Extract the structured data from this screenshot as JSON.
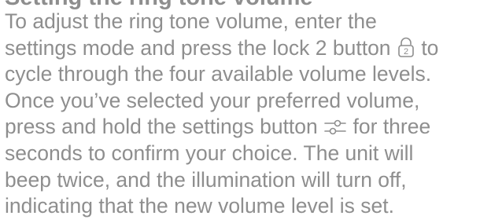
{
  "title": "Setting the ring tone volume",
  "paragraph": {
    "line1": "To adjust the ring tone volume, enter the",
    "line2_before_icon": "settings mode and press the lock 2 button",
    "line2_after_icon": "to",
    "line3": "cycle through the four available volume levels.",
    "line4": "Once you’ve selected your preferred volume,",
    "line5_before_icon": "press and hold the settings button",
    "line5_after_icon": "for three",
    "line6": "seconds to confirm your choice. The unit will",
    "line7": "beep twice, and the illumination will turn off,",
    "line8": "indicating that the new volume level is set."
  },
  "icons": {
    "lock": "lock-2-icon",
    "lock_number": "2",
    "settings": "settings-sliders-icon"
  },
  "colors": {
    "text": "#8e8e8e",
    "background": "#ffffff"
  }
}
